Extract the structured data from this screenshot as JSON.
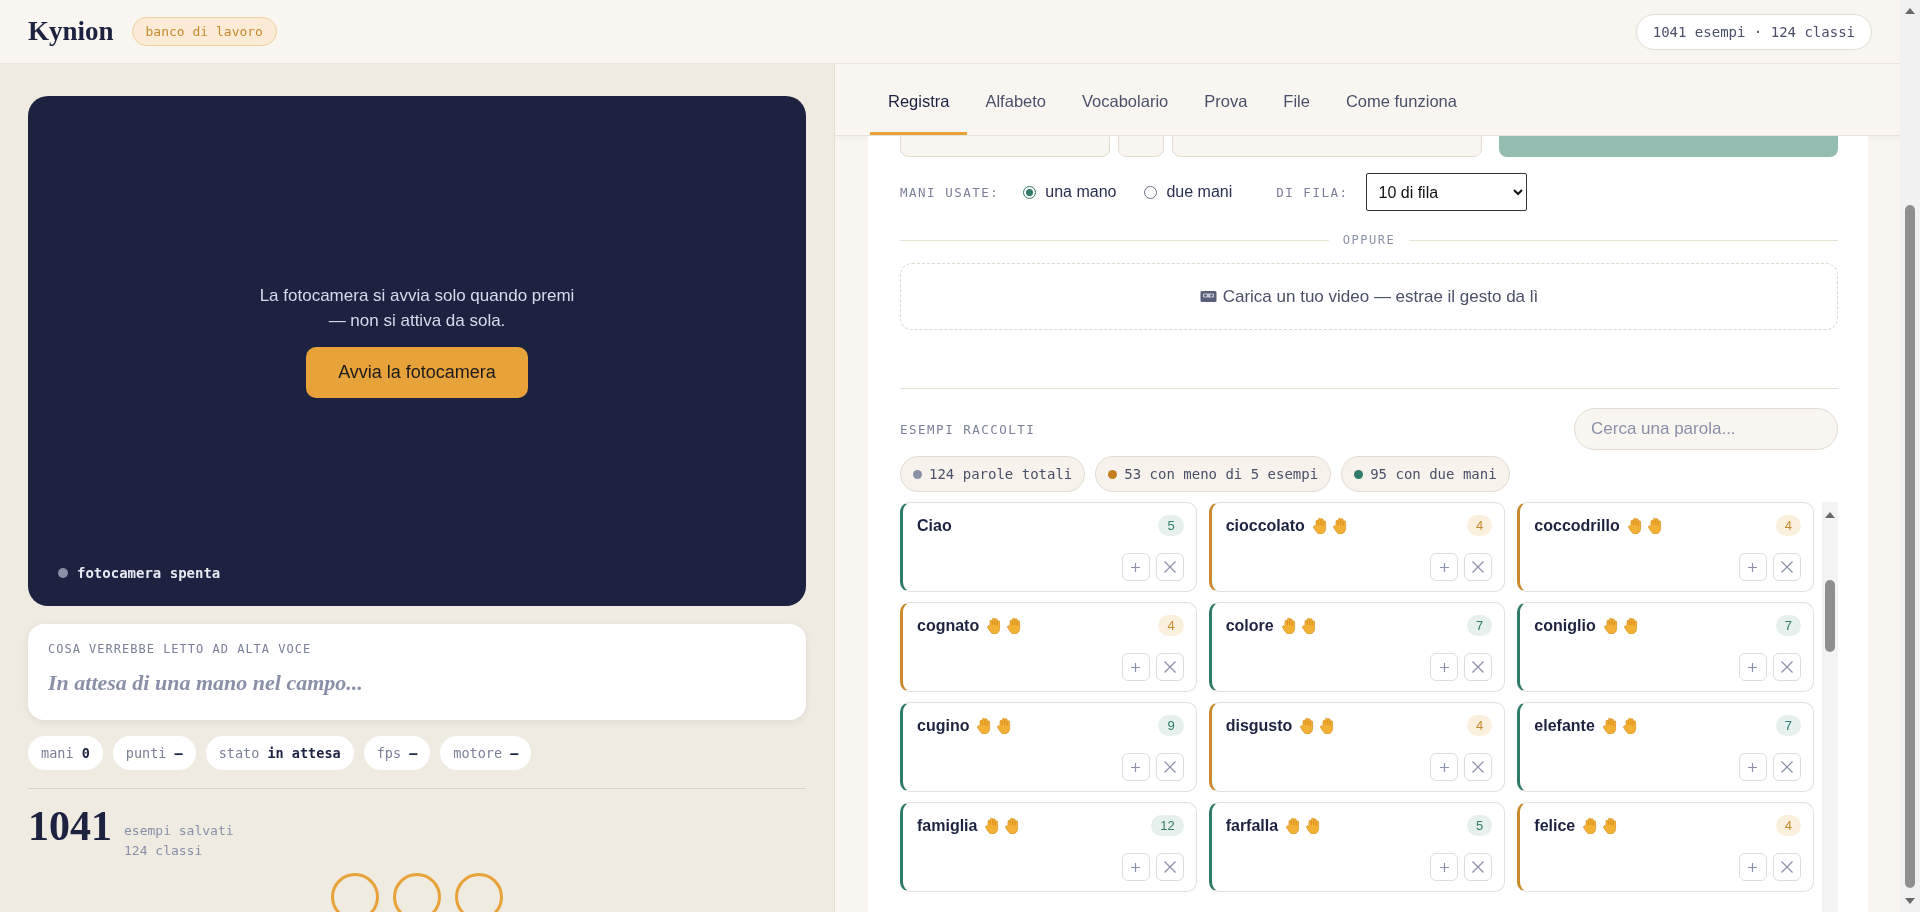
{
  "header": {
    "logo": "Kynion",
    "badge": "banco di lavoro",
    "summary": "1041 esempi · 124 classi"
  },
  "camera": {
    "message": "La fotocamera si avvia solo quando premi — non si attiva da sola.",
    "button": "Avvia la fotocamera",
    "status": "fotocamera spenta",
    "on": false
  },
  "readout": {
    "label": "COSA VERREBBE LETTO AD ALTA VOCE",
    "text": "In attesa di una mano nel campo..."
  },
  "stats": [
    {
      "label": "mani",
      "value": "0"
    },
    {
      "label": "punti",
      "value": "—"
    },
    {
      "label": "stato",
      "value": "in attesa"
    },
    {
      "label": "fps",
      "value": "—"
    },
    {
      "label": "motore",
      "value": "—"
    }
  ],
  "totals": {
    "count": "1041",
    "caption": "esempi salvati",
    "classes": "124 classi"
  },
  "tabs": [
    {
      "label": "Registra",
      "selected": true
    },
    {
      "label": "Alfabeto",
      "selected": false
    },
    {
      "label": "Vocabolario",
      "selected": false
    },
    {
      "label": "Prova",
      "selected": false
    },
    {
      "label": "File",
      "selected": false
    },
    {
      "label": "Come funziona",
      "selected": false
    }
  ],
  "hands": {
    "label": "MANI USATE:",
    "options": [
      {
        "label": "una mano",
        "selected": true
      },
      {
        "label": "due mani",
        "selected": false
      }
    ]
  },
  "repeat": {
    "label": "DI FILA:",
    "value": "10 di fila"
  },
  "divider": "OPPURE",
  "upload": "Carica un tuo video — estrae il gesto da lì",
  "collected": {
    "title": "ESEMPI RACCOLTI",
    "search_placeholder": "Cerca una parola...",
    "filters": [
      {
        "label": "124 parole totali",
        "color": "#8a90a8"
      },
      {
        "label": "53 con meno di 5 esempi",
        "color": "#c47f1f"
      },
      {
        "label": "95 con due mani",
        "color": "#2f7a68"
      }
    ],
    "words": [
      {
        "name": "Ciao",
        "two_hands": false,
        "count": "5",
        "low": false
      },
      {
        "name": "cioccolato",
        "two_hands": true,
        "count": "4",
        "low": true
      },
      {
        "name": "coccodrillo",
        "two_hands": true,
        "count": "4",
        "low": true
      },
      {
        "name": "cognato",
        "two_hands": true,
        "count": "4",
        "low": true
      },
      {
        "name": "colore",
        "two_hands": true,
        "count": "7",
        "low": false
      },
      {
        "name": "coniglio",
        "two_hands": true,
        "count": "7",
        "low": false
      },
      {
        "name": "cugino",
        "two_hands": true,
        "count": "9",
        "low": false
      },
      {
        "name": "disgusto",
        "two_hands": true,
        "count": "4",
        "low": true
      },
      {
        "name": "elefante",
        "two_hands": true,
        "count": "7",
        "low": false
      },
      {
        "name": "famiglia",
        "two_hands": true,
        "count": "12",
        "low": false
      },
      {
        "name": "farfalla",
        "two_hands": true,
        "count": "5",
        "low": false
      },
      {
        "name": "felice",
        "two_hands": true,
        "count": "4",
        "low": true
      }
    ]
  }
}
